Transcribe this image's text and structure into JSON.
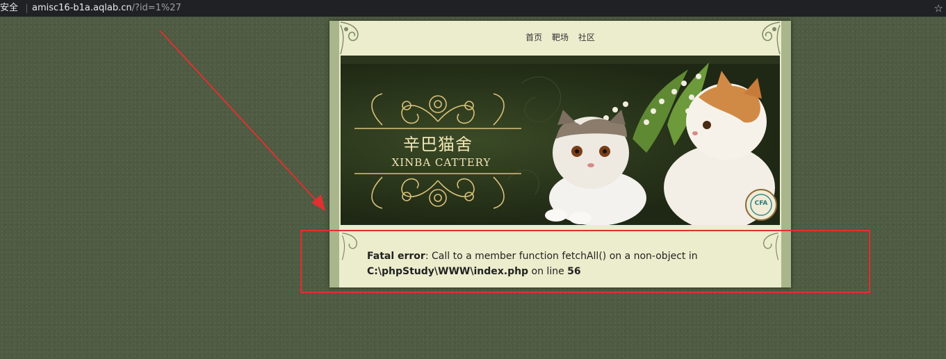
{
  "browser": {
    "security_label": "安全",
    "url_host": "amisc16-b1a.aqlab.cn",
    "url_path": "/?id=1%27"
  },
  "nav": {
    "items": [
      "首页",
      "靶场",
      "社区"
    ]
  },
  "banner": {
    "title_cn": "辛巴猫舍",
    "title_en": "XINBA CATTERY",
    "seal_text": "CFA"
  },
  "error": {
    "label": "Fatal error",
    "message": ": Call to a member function fetchAll() on a non-object in",
    "file": "C:\\phpStudy\\WWW\\index.php",
    "line_prefix": " on line ",
    "line_number": "56"
  },
  "colors": {
    "background": "#4f5b42",
    "annotation": "#e03030",
    "page_bg": "#ecedcd"
  }
}
